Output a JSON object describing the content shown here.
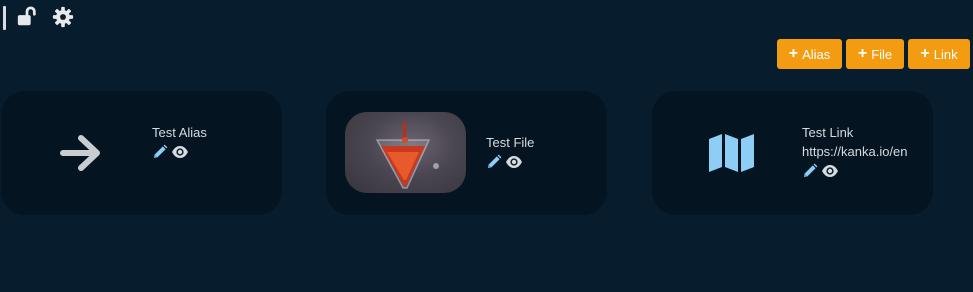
{
  "toolbar": {
    "icons": [
      "lock-open-icon",
      "gear-icon"
    ]
  },
  "actions": {
    "alias_label": "Alias",
    "file_label": "File",
    "link_label": "Link"
  },
  "cards": [
    {
      "title": "Test Alias",
      "icon": "arrow-right-icon"
    },
    {
      "title": "Test File",
      "thumbnail": "image-preview"
    },
    {
      "title": "Test Link",
      "url": "https://kanka.io/en",
      "icon": "map-icon"
    }
  ],
  "colors": {
    "background": "#071c2c",
    "card": "#041420",
    "accent": "#f39c12",
    "icon_blue": "#8ecdf5"
  }
}
